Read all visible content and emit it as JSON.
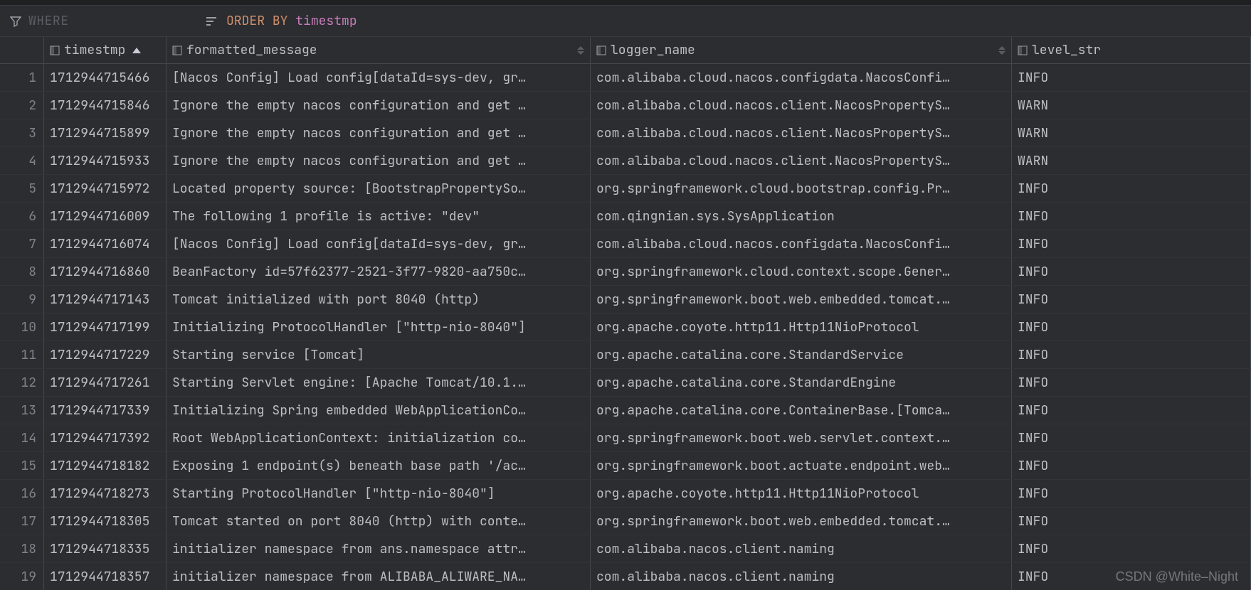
{
  "filter": {
    "where_placeholder": "WHERE",
    "order_prefix": "ORDER",
    "order_by": "BY",
    "order_column": "timestmp"
  },
  "columns": {
    "timestmp": "timestmp",
    "formatted_message": "formatted_message",
    "logger_name": "logger_name",
    "level_string": "level_str"
  },
  "rows": [
    {
      "n": "1",
      "timestmp": "1712944715466",
      "msg": "[Nacos Config] Load config[dataId=sys-dev, gr…",
      "logger": "com.alibaba.cloud.nacos.configdata.NacosConfi…",
      "level": "INFO"
    },
    {
      "n": "2",
      "timestmp": "1712944715846",
      "msg": "Ignore the empty nacos configuration and get …",
      "logger": "com.alibaba.cloud.nacos.client.NacosPropertyS…",
      "level": "WARN"
    },
    {
      "n": "3",
      "timestmp": "1712944715899",
      "msg": "Ignore the empty nacos configuration and get …",
      "logger": "com.alibaba.cloud.nacos.client.NacosPropertyS…",
      "level": "WARN"
    },
    {
      "n": "4",
      "timestmp": "1712944715933",
      "msg": "Ignore the empty nacos configuration and get …",
      "logger": "com.alibaba.cloud.nacos.client.NacosPropertyS…",
      "level": "WARN"
    },
    {
      "n": "5",
      "timestmp": "1712944715972",
      "msg": "Located property source: [BootstrapPropertySo…",
      "logger": "org.springframework.cloud.bootstrap.config.Pr…",
      "level": "INFO"
    },
    {
      "n": "6",
      "timestmp": "1712944716009",
      "msg": "The following 1 profile is active: \"dev\"",
      "logger": "com.qingnian.sys.SysApplication",
      "level": "INFO"
    },
    {
      "n": "7",
      "timestmp": "1712944716074",
      "msg": "[Nacos Config] Load config[dataId=sys-dev, gr…",
      "logger": "com.alibaba.cloud.nacos.configdata.NacosConfi…",
      "level": "INFO"
    },
    {
      "n": "8",
      "timestmp": "1712944716860",
      "msg": "BeanFactory id=57f62377-2521-3f77-9820-aa750c…",
      "logger": "org.springframework.cloud.context.scope.Gener…",
      "level": "INFO"
    },
    {
      "n": "9",
      "timestmp": "1712944717143",
      "msg": "Tomcat initialized with port 8040 (http)",
      "logger": "org.springframework.boot.web.embedded.tomcat.…",
      "level": "INFO"
    },
    {
      "n": "10",
      "timestmp": "1712944717199",
      "msg": "Initializing ProtocolHandler [\"http-nio-8040\"]",
      "logger": "org.apache.coyote.http11.Http11NioProtocol",
      "level": "INFO"
    },
    {
      "n": "11",
      "timestmp": "1712944717229",
      "msg": "Starting service [Tomcat]",
      "logger": "org.apache.catalina.core.StandardService",
      "level": "INFO"
    },
    {
      "n": "12",
      "timestmp": "1712944717261",
      "msg": "Starting Servlet engine: [Apache Tomcat/10.1.…",
      "logger": "org.apache.catalina.core.StandardEngine",
      "level": "INFO"
    },
    {
      "n": "13",
      "timestmp": "1712944717339",
      "msg": "Initializing Spring embedded WebApplicationCo…",
      "logger": "org.apache.catalina.core.ContainerBase.[Tomca…",
      "level": "INFO"
    },
    {
      "n": "14",
      "timestmp": "1712944717392",
      "msg": "Root WebApplicationContext: initialization co…",
      "logger": "org.springframework.boot.web.servlet.context.…",
      "level": "INFO"
    },
    {
      "n": "15",
      "timestmp": "1712944718182",
      "msg": "Exposing 1 endpoint(s) beneath base path '/ac…",
      "logger": "org.springframework.boot.actuate.endpoint.web…",
      "level": "INFO"
    },
    {
      "n": "16",
      "timestmp": "1712944718273",
      "msg": "Starting ProtocolHandler [\"http-nio-8040\"]",
      "logger": "org.apache.coyote.http11.Http11NioProtocol",
      "level": "INFO"
    },
    {
      "n": "17",
      "timestmp": "1712944718305",
      "msg": "Tomcat started on port 8040 (http) with conte…",
      "logger": "org.springframework.boot.web.embedded.tomcat.…",
      "level": "INFO"
    },
    {
      "n": "18",
      "timestmp": "1712944718335",
      "msg": "initializer namespace from ans.namespace attr…",
      "logger": "com.alibaba.nacos.client.naming",
      "level": "INFO"
    },
    {
      "n": "19",
      "timestmp": "1712944718357",
      "msg": "initializer namespace from ALIBABA_ALIWARE_NA…",
      "logger": "com.alibaba.nacos.client.naming",
      "level": "INFO"
    }
  ],
  "watermark": "CSDN @White–Night"
}
